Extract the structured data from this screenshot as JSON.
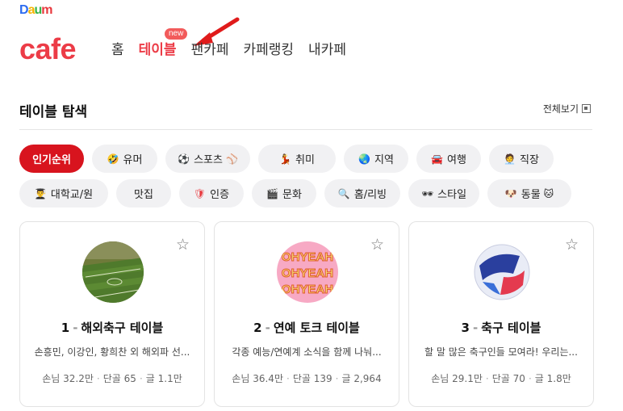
{
  "header": {
    "daum_logo": "Daum",
    "cafe_logo": "cafe",
    "new_badge": "new",
    "nav": [
      {
        "label": "홈"
      },
      {
        "label": "테이블"
      },
      {
        "label": "팬카페"
      },
      {
        "label": "카페랭킹"
      },
      {
        "label": "내카페"
      }
    ]
  },
  "section": {
    "title": "테이블 탐색",
    "view_all": "전체보기"
  },
  "chips": {
    "row1": [
      {
        "label": "인기순위",
        "icon": ""
      },
      {
        "label": "유머",
        "icon": "🤣"
      },
      {
        "label": "스포츠",
        "icon": "⚽",
        "icon2": "⚾"
      },
      {
        "label": "취미",
        "icon": "💃"
      },
      {
        "label": "지역",
        "icon": "🌏"
      },
      {
        "label": "여행",
        "icon": "🚘"
      },
      {
        "label": "직장",
        "icon": "🧑‍💼"
      }
    ],
    "row2": [
      {
        "label": "대학교/원",
        "icon": "👨‍🎓"
      },
      {
        "label": "맛집",
        "icon": ""
      },
      {
        "label": "인증",
        "icon": "🛡"
      },
      {
        "label": "문화",
        "icon": "🎬"
      },
      {
        "label": "홈/리빙",
        "icon": "🔍"
      },
      {
        "label": "스타일",
        "icon": "🕶"
      },
      {
        "label": "동물",
        "icon": "🐶",
        "icon2": "🐱"
      }
    ]
  },
  "cards": [
    {
      "rank": "1",
      "dash": "-",
      "title": "해외축구 테이블",
      "desc": "손흥민, 이강인, 황희찬 외 해외파 선...",
      "members_label": "손님",
      "members": "32.2만",
      "regulars_label": "단골",
      "regulars": "65",
      "posts_label": "글",
      "posts": "1.1만",
      "star": "☆"
    },
    {
      "rank": "2",
      "dash": "-",
      "title": "연예 토크 테이블",
      "desc": "각종 예능/연예계 소식을 함께 나눠...",
      "members_label": "손님",
      "members": "36.4만",
      "regulars_label": "단골",
      "regulars": "139",
      "posts_label": "글",
      "posts": "2,964",
      "star": "☆"
    },
    {
      "rank": "3",
      "dash": "-",
      "title": "축구 테이블",
      "desc": "할 말 많은 축구인들 모여라! 우리는...",
      "members_label": "손님",
      "members": "29.1만",
      "regulars_label": "단골",
      "regulars": "70",
      "posts_label": "글",
      "posts": "1.8만",
      "star": "☆"
    }
  ],
  "colors": {
    "accent": "#ec3c47",
    "chip_active": "#d8141e",
    "chip_bg": "#f1f1f3"
  }
}
